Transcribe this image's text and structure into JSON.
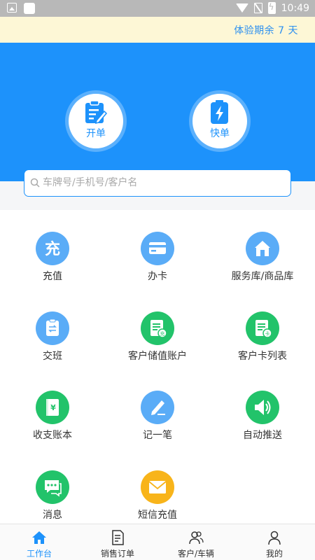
{
  "status_bar": {
    "time": "10:49"
  },
  "trial_banner": {
    "text": "体验期余 7 天"
  },
  "quick_actions": [
    {
      "label": "开单",
      "icon": "clipboard-edit-icon"
    },
    {
      "label": "快单",
      "icon": "battery-bolt-icon"
    }
  ],
  "search": {
    "placeholder": "车牌号/手机号/客户名",
    "value": ""
  },
  "grid": [
    {
      "label": "充值",
      "icon": "recharge-icon",
      "color": "#5aacf7"
    },
    {
      "label": "办卡",
      "icon": "card-icon",
      "color": "#5aacf7"
    },
    {
      "label": "服务库/商品库",
      "icon": "store-icon",
      "color": "#5aacf7"
    },
    {
      "label": "交班",
      "icon": "shift-handover-icon",
      "color": "#5aacf7"
    },
    {
      "label": "客户储值账户",
      "icon": "stored-value-ledger-icon",
      "color": "#22c36a"
    },
    {
      "label": "客户卡列表",
      "icon": "card-list-ledger-icon",
      "color": "#22c36a"
    },
    {
      "label": "收支账本",
      "icon": "accounts-book-icon",
      "color": "#22c36a"
    },
    {
      "label": "记一笔",
      "icon": "pen-write-icon",
      "color": "#5aacf7"
    },
    {
      "label": "自动推送",
      "icon": "speaker-icon",
      "color": "#22c36a"
    },
    {
      "label": "消息",
      "icon": "chat-icon",
      "color": "#22c36a"
    },
    {
      "label": "短信充值",
      "icon": "envelope-icon",
      "color": "#f8b41a"
    }
  ],
  "recharge_glyph": "充",
  "bottom_nav": [
    {
      "label": "工作台",
      "icon": "home-icon",
      "active": true
    },
    {
      "label": "销售订单",
      "icon": "order-doc-icon",
      "active": false
    },
    {
      "label": "客户/车辆",
      "icon": "customers-icon",
      "active": false
    },
    {
      "label": "我的",
      "icon": "user-icon",
      "active": false
    }
  ],
  "colors": {
    "primary": "#1d92fb",
    "green": "#22c36a",
    "light_blue": "#5aacf7",
    "yellow": "#f8b41a",
    "banner_bg": "#fdf7d6"
  }
}
